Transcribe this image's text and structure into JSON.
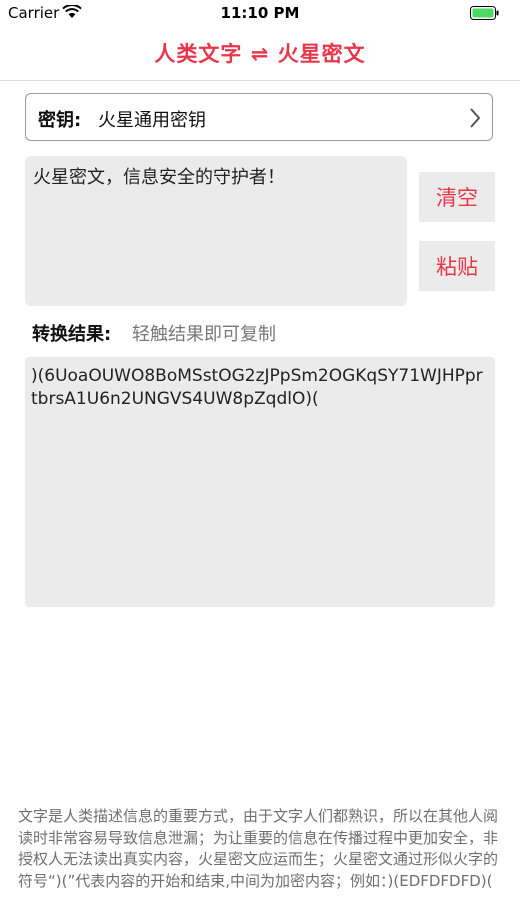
{
  "status_bar": {
    "carrier": "Carrier",
    "time": "11:10 PM",
    "battery_color": "#4cd964"
  },
  "nav": {
    "title": "人类文字 ⇌ 火星密文",
    "title_color": "#e8374a"
  },
  "key_selector": {
    "label": "密钥:",
    "value": "火星通用密钥",
    "icon": "chevron-right-icon"
  },
  "input": {
    "text": "火星密文，信息安全的守护者！"
  },
  "buttons": {
    "clear_label": "清空",
    "paste_label": "粘贴"
  },
  "result": {
    "label": "转换结果:",
    "hint": "轻触结果即可复制",
    "output": ")(6UoaOUWO8BoMSstOG2zJPpSm2OGKqSY71WJHPprtbrsA1U6n2UNGVS4UW8pZqdlO)("
  },
  "description": "文字是人类描述信息的重要方式，由于文字人们都熟识，所以在其他人阅读时非常容易导致信息泄漏；为让重要的信息在传播过程中更加安全，非授权人无法读出真实内容，火星密文应运而生；火星密文通过形似火字的符号“)(”代表内容的开始和结束,中间为加密内容；例如：)(EDFDFDFD)("
}
